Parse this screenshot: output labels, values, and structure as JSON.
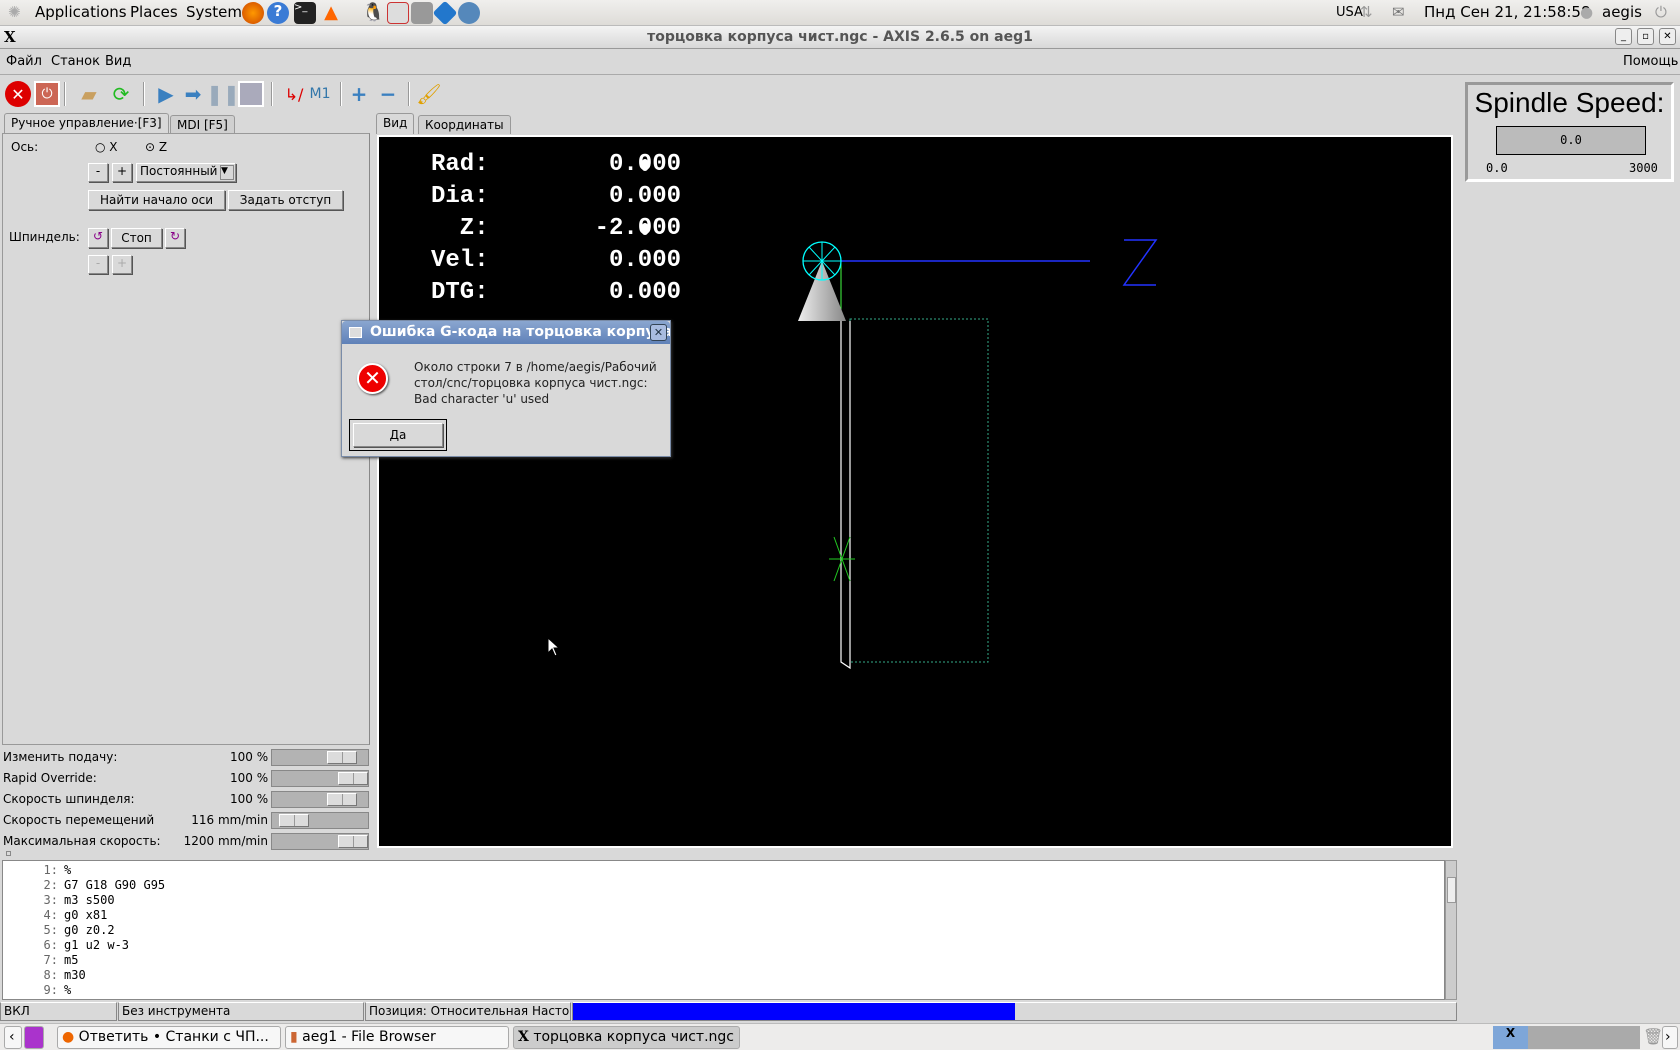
{
  "top_panel": {
    "menus": [
      "Applications",
      "Places",
      "System"
    ],
    "keyboard": "USA",
    "clock": "Пнд Сен 21, 21:58:58",
    "user": "aegis"
  },
  "window": {
    "title": "торцовка корпуса чист.ngc - AXIS 2.6.5 on aeg1"
  },
  "menu": {
    "items": [
      "Файл",
      "Станок",
      "Вид"
    ],
    "help": "Помощь"
  },
  "left_tabs": [
    "Ручное управление·[F3]",
    "MDI [F5]"
  ],
  "manual": {
    "axis_label": "Ось:",
    "axis_options": [
      "X",
      "Z"
    ],
    "axis_selected": "Z",
    "minus": "-",
    "plus": "+",
    "jog_mode": "Постоянный",
    "home_button": "Найти начало оси",
    "touch_off_button": "Задать отступ",
    "spindle_label": "Шпиндель:",
    "spindle_stop": "Стоп"
  },
  "overrides": [
    {
      "label": "Изменить подачу:",
      "value": "100 %",
      "fraction": 0.83
    },
    {
      "label": "Rapid Override:",
      "value": "100 %",
      "fraction": 1.0
    },
    {
      "label": "Скорость шпинделя:",
      "value": "100 %",
      "fraction": 0.83
    },
    {
      "label": "Скорость перемещений",
      "value": "116 mm/min",
      "fraction": 0.1
    },
    {
      "label": "Максимальная скорость:",
      "value": "1200 mm/min",
      "fraction": 1.0
    }
  ],
  "preview_tabs": [
    "Вид",
    "Координаты"
  ],
  "dro": [
    {
      "label": "Rad:",
      "value": "0.000"
    },
    {
      "label": "Dia:",
      "value": "0.000"
    },
    {
      "label": "  Z:",
      "value": "-2.000"
    },
    {
      "label": "Vel:",
      "value": "0.000"
    },
    {
      "label": "DTG:",
      "value": "0.000"
    }
  ],
  "axis_glyph": "Z",
  "spindle_speed": {
    "title": "Spindle Speed:",
    "value": "0.0",
    "min": "0.0",
    "max": "3000"
  },
  "dialog": {
    "title": "Ошибка G-кода на торцовка корпуса чист.ngc",
    "message_lines": [
      "Около строки 7 в /home/aegis/Рабочий",
      "стол/cnc/торцовка корпуса чист.ngc:",
      "Bad character 'u' used"
    ],
    "ok": "Да"
  },
  "gcode": [
    {
      "n": "1:",
      "c": "%"
    },
    {
      "n": "2:",
      "c": "G7 G18 G90 G95"
    },
    {
      "n": "3:",
      "c": "m3 s500"
    },
    {
      "n": "4:",
      "c": "g0 x81"
    },
    {
      "n": "5:",
      "c": "g0 z0.2"
    },
    {
      "n": "6:",
      "c": "g1 u2 w-3"
    },
    {
      "n": "7:",
      "c": "m5"
    },
    {
      "n": "8:",
      "c": "m30"
    },
    {
      "n": "9:",
      "c": "%"
    }
  ],
  "status": {
    "state": "ВКЛ",
    "tool": "Без инструмента",
    "position": "Позиция: Относительная Настоящая",
    "progress_fraction": 0.5,
    "progress_color": "#0000ff"
  },
  "taskbar": {
    "tasks": [
      "Ответить • Станки с ЧП...",
      "aeg1 - File Browser",
      "торцовка корпуса чист.ngc"
    ]
  }
}
